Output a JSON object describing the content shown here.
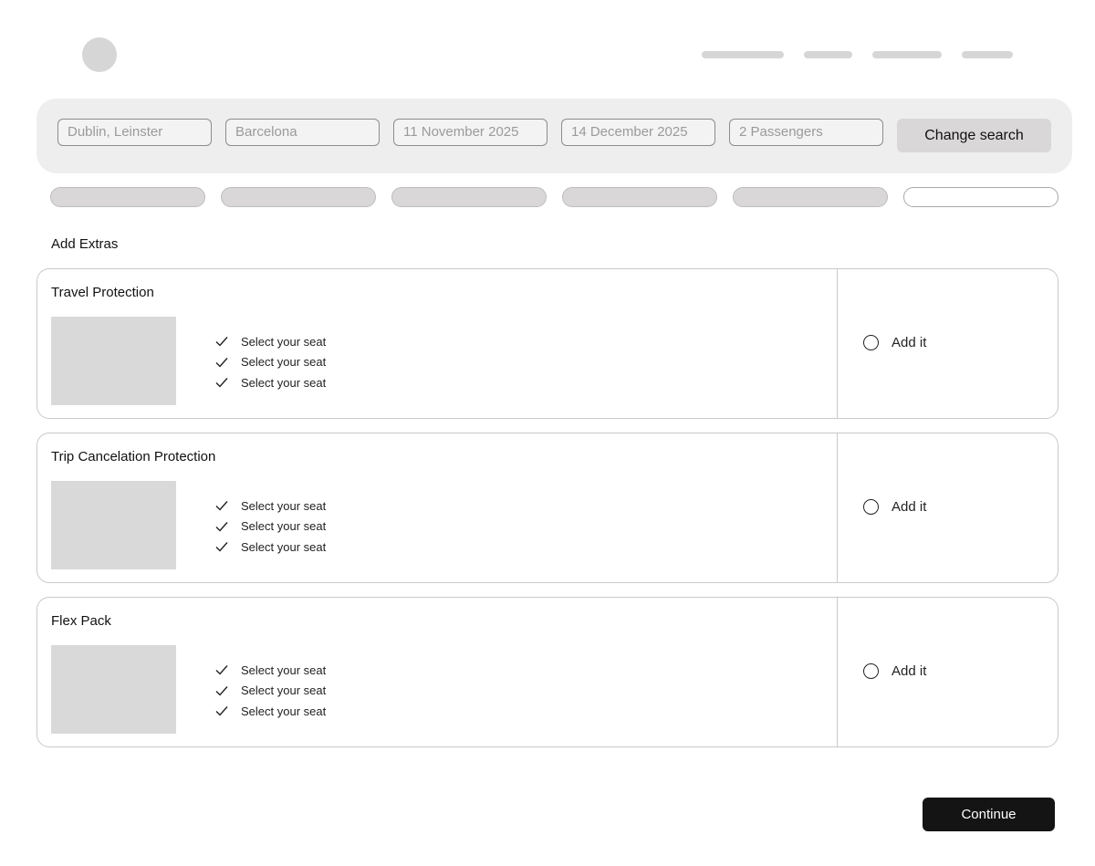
{
  "search": {
    "origin": "Dublin, Leinster",
    "destination": "Barcelona",
    "depart_date": "11 November 2025",
    "return_date": "14 December 2025",
    "passengers": "2 Passengers",
    "change_label": "Change search"
  },
  "section_title": "Add Extras",
  "extras": [
    {
      "title": "Travel Protection",
      "features": [
        "Select your seat",
        "Select your seat",
        "Select your seat"
      ],
      "add_label": "Add it"
    },
    {
      "title": "Trip Cancelation Protection",
      "features": [
        "Select your seat",
        "Select your seat",
        "Select your seat"
      ],
      "add_label": "Add it"
    },
    {
      "title": "Flex Pack",
      "features": [
        "Select your seat",
        "Select your seat",
        "Select your seat"
      ],
      "add_label": "Add it"
    }
  ],
  "continue_label": "Continue"
}
